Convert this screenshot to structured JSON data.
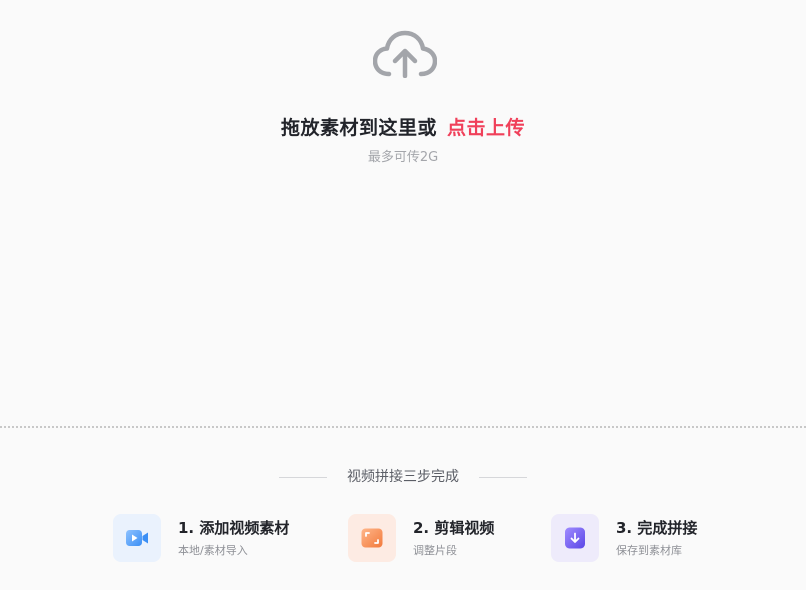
{
  "upload": {
    "headline": "拖放素材到这里或",
    "link_label": "点击上传",
    "limit": "最多可传2G",
    "icon": "cloud-upload-icon"
  },
  "steps_section": {
    "title": "视频拼接三步完成",
    "steps": [
      {
        "title": "1. 添加视频素材",
        "subtitle": "本地/素材导入",
        "icon": "video-camera-icon",
        "color": "#3b8ff5"
      },
      {
        "title": "2. 剪辑视频",
        "subtitle": "调整片段",
        "icon": "crop-frame-icon",
        "color": "#f27a3c"
      },
      {
        "title": "3. 完成拼接",
        "subtitle": "保存到素材库",
        "icon": "download-arrow-icon",
        "color": "#6a57ee"
      }
    ]
  },
  "colors": {
    "accent": "#f0405a",
    "background": "#fafafa",
    "text_primary": "#22242a",
    "text_muted": "#a4a6ab"
  }
}
